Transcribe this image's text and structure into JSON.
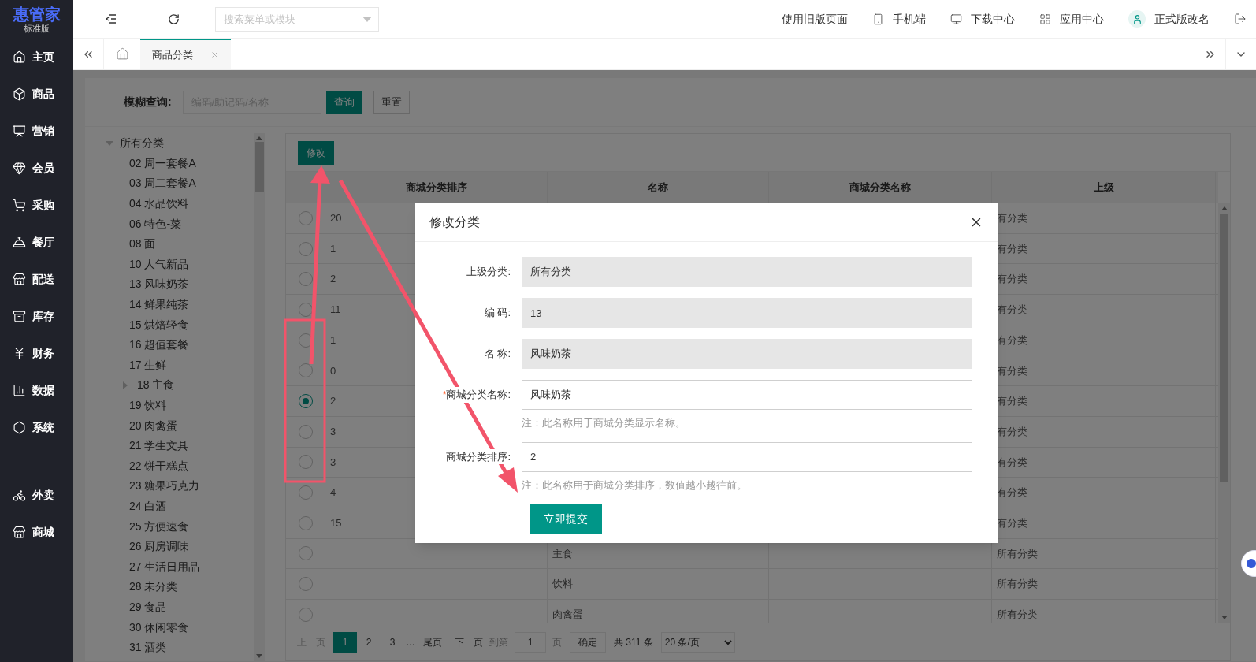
{
  "logo": {
    "name": "惠管家",
    "edition": "标准版"
  },
  "sidebar": {
    "menu": [
      {
        "label": "主页"
      },
      {
        "label": "商品"
      },
      {
        "label": "营销"
      },
      {
        "label": "会员"
      },
      {
        "label": "采购"
      },
      {
        "label": "餐厅"
      },
      {
        "label": "配送"
      },
      {
        "label": "库存"
      },
      {
        "label": "财务"
      },
      {
        "label": "数据"
      },
      {
        "label": "系统"
      }
    ],
    "extra_menu": [
      {
        "label": "外卖"
      },
      {
        "label": "商城"
      }
    ]
  },
  "topbar": {
    "search": {
      "placeholder": "搜索菜单或模块"
    },
    "links": [
      {
        "label": "使用旧版页面"
      },
      {
        "label": "手机端"
      },
      {
        "label": "下载中心"
      },
      {
        "label": "应用中心"
      },
      {
        "label": "正式版改名"
      }
    ]
  },
  "tabs": [
    {
      "label": "商品分类",
      "selected": true
    }
  ],
  "filter": {
    "label": "模糊查询:",
    "placeholder": "编码/助记码/名称",
    "buttons": [
      "查询",
      "重置"
    ]
  },
  "tree": [
    {
      "label": "所有分类",
      "kind": "group",
      "expanded": true,
      "children": [
        {
          "label": "02 周一套餐A",
          "kind": "leaf"
        },
        {
          "label": "03 周二套餐A",
          "kind": "leaf"
        },
        {
          "label": "04 水品饮料",
          "kind": "leaf"
        },
        {
          "label": "06 特色-菜",
          "kind": "leaf"
        },
        {
          "label": "08 面",
          "kind": "leaf"
        },
        {
          "label": "10 人气新品",
          "kind": "leaf"
        },
        {
          "label": "13 风味奶茶",
          "kind": "leaf"
        },
        {
          "label": "14 鲜果纯茶",
          "kind": "leaf"
        },
        {
          "label": "15 烘焙轻食",
          "kind": "leaf"
        },
        {
          "label": "16 超值套餐",
          "kind": "leaf"
        },
        {
          "label": "17 生鲜",
          "kind": "leaf"
        },
        {
          "label": "18 主食",
          "kind": "group",
          "expanded": false
        },
        {
          "label": "19 饮料",
          "kind": "leaf"
        },
        {
          "label": "20 肉禽蛋",
          "kind": "leaf"
        },
        {
          "label": "21 学生文具",
          "kind": "leaf"
        },
        {
          "label": "22 饼干糕点",
          "kind": "leaf"
        },
        {
          "label": "23 糖果巧克力",
          "kind": "leaf"
        },
        {
          "label": "24 白酒",
          "kind": "leaf"
        },
        {
          "label": "25 方便速食",
          "kind": "leaf"
        },
        {
          "label": "26 厨房调味",
          "kind": "leaf"
        },
        {
          "label": "27 生活日用品",
          "kind": "leaf"
        },
        {
          "label": "28 未分类",
          "kind": "leaf"
        },
        {
          "label": "29 食品",
          "kind": "leaf"
        },
        {
          "label": "30 休闲零食",
          "kind": "leaf"
        },
        {
          "label": "31 酒类",
          "kind": "leaf"
        }
      ]
    }
  ],
  "table": {
    "toolbar_button": "修改",
    "columns": [
      "商城分类排序",
      "名称",
      "商城分类名称",
      "上级"
    ],
    "rows": [
      {
        "selected": false,
        "sort": "20",
        "parent": "有分类"
      },
      {
        "selected": false,
        "sort": "1",
        "parent": "有分类"
      },
      {
        "selected": false,
        "sort": "2",
        "parent": "有分类"
      },
      {
        "selected": false,
        "sort": "11",
        "parent": "有分类"
      },
      {
        "selected": false,
        "sort": "1",
        "parent": "有分类"
      },
      {
        "selected": false,
        "sort": "0",
        "parent": "有分类"
      },
      {
        "selected": true,
        "sort": "2",
        "parent": "有分类"
      },
      {
        "selected": false,
        "sort": "3",
        "parent": "有分类"
      },
      {
        "selected": false,
        "sort": "3",
        "parent": "有分类"
      },
      {
        "selected": false,
        "sort": "4",
        "parent": "有分类"
      },
      {
        "selected": false,
        "sort": "15",
        "parent": "有分类"
      },
      {
        "selected": false,
        "name": "主食",
        "parent": "所有分类"
      },
      {
        "selected": false,
        "name": "饮料",
        "parent": "所有分类"
      },
      {
        "selected": false,
        "name": "肉禽蛋",
        "parent": "所有分类"
      }
    ]
  },
  "pagination": {
    "prev": "上一页",
    "pages": [
      {
        "label": "1",
        "selected": true
      },
      {
        "label": "2",
        "selected": false
      },
      {
        "label": "3",
        "selected": false
      }
    ],
    "ellipsis": "…",
    "last": "尾页",
    "next": "下一页",
    "goto_label": "到第",
    "goto_value": "1",
    "page_unit": "页",
    "confirm": "确定",
    "total": "共 311 条",
    "page_size": "20 条/页"
  },
  "dialog": {
    "title": "修改分类",
    "fields": [
      {
        "label": "上级分类:",
        "value": "所有分类",
        "readonly": true
      },
      {
        "label": "编 码:",
        "value": "13",
        "readonly": true
      },
      {
        "label": "名 称:",
        "value": "风味奶茶",
        "readonly": true
      },
      {
        "label": "商城分类名称:",
        "required_mark": "*",
        "value": "风味奶茶",
        "readonly": false,
        "note": "注：此名称用于商城分类显示名称。"
      },
      {
        "label": "商城分类排序:",
        "value": "2",
        "readonly": false,
        "note": "注：此名称用于商城分类排序，数值越小越往前。"
      }
    ],
    "submit": "立即提交"
  }
}
